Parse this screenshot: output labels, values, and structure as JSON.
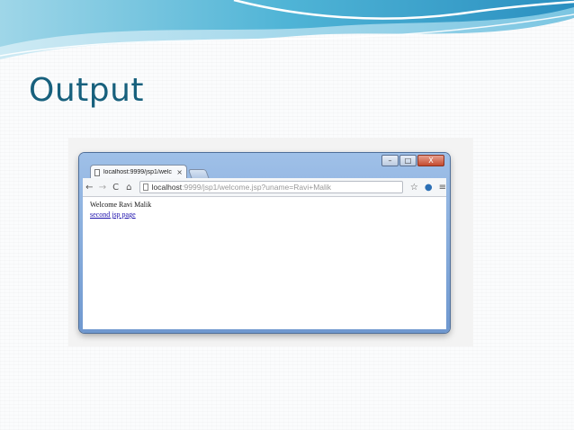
{
  "slide": {
    "title": "Output"
  },
  "browser": {
    "tab": {
      "title": "localhost:9999/jsp1/welc",
      "close_glyph": "×"
    },
    "window_controls": {
      "minimize": "–",
      "maximize": "□",
      "close": "X"
    },
    "toolbar": {
      "back_glyph": "←",
      "forward_glyph": "→",
      "reload_glyph": "C",
      "home_glyph": "⌂",
      "url_host": "localhost",
      "url_rest": ":9999/jsp1/welcome.jsp?uname=Ravi+Malik",
      "star_glyph": "☆",
      "extension_glyph": "●",
      "menu_glyph": "≡"
    },
    "page": {
      "welcome_text": "Welcome Ravi Malik",
      "link_text": "second jsp page"
    }
  },
  "colors": {
    "title": "#17607d",
    "link": "#1a0dab",
    "frame": "#6f98cf"
  }
}
